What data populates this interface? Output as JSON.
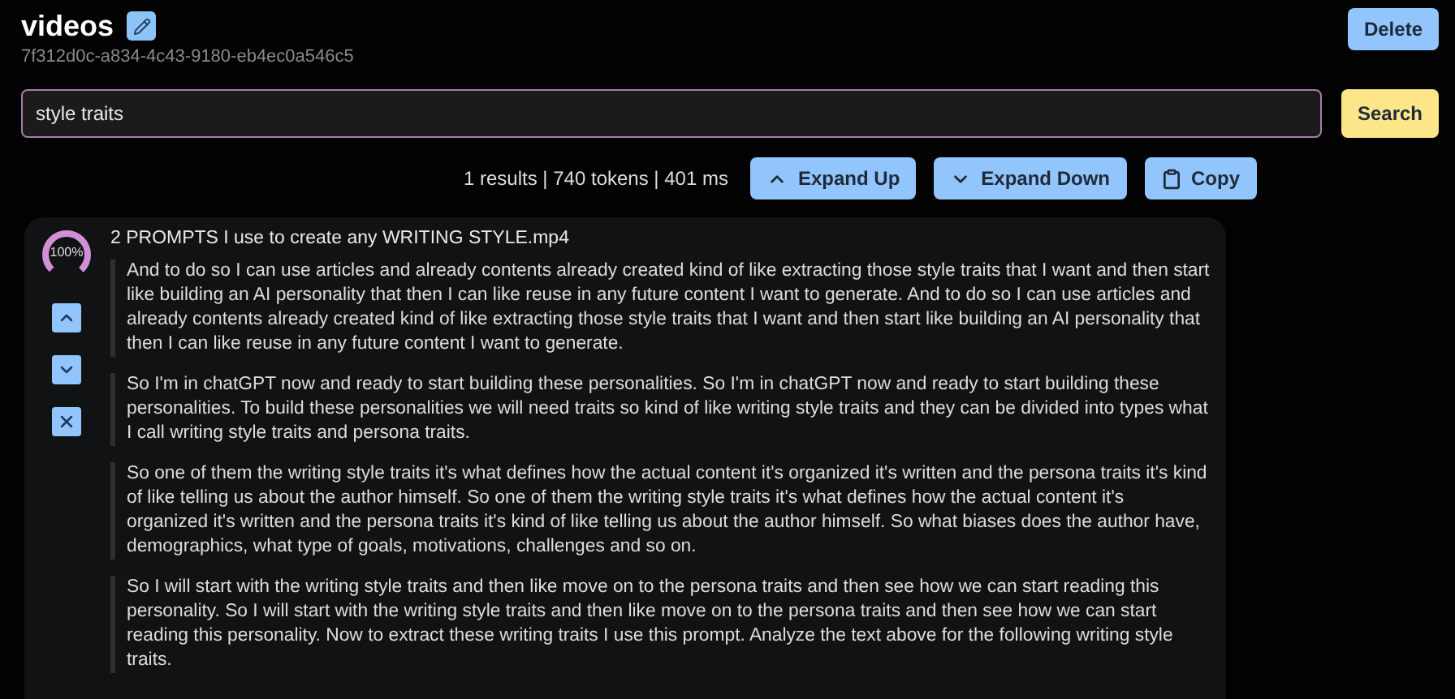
{
  "header": {
    "title": "videos",
    "id": "7f312d0c-a834-4c43-9180-eb4ec0a546c5",
    "delete_label": "Delete"
  },
  "search": {
    "value": "style traits",
    "button": "Search"
  },
  "stats": "1 results | 740 tokens | 401 ms",
  "actions": [
    {
      "kind": "up",
      "label": "Expand Up"
    },
    {
      "kind": "down",
      "label": "Expand Down"
    },
    {
      "kind": "copy",
      "label": "Copy"
    }
  ],
  "result": {
    "score": {
      "reading": "100%"
    },
    "file": "2 PROMPTS I use to create any WRITING STYLE.mp4",
    "controls": [
      {
        "kind": "up"
      },
      {
        "kind": "down"
      },
      {
        "kind": "close"
      }
    ],
    "paragraphs": [
      "And to do so I can use articles and already contents already created kind of like extracting those style traits that I want and then start like building an AI personality that then I can like reuse in any future content I want to generate. And to do so I can use articles and already contents already created kind of like extracting those style traits that I want and then start like building an AI personality that then I can like reuse in any future content I want to generate.",
      "So I'm in chatGPT now and ready to start building these personalities. So I'm in chatGPT now and ready to start building these personalities. To build these personalities we will need traits so kind of like writing style traits and they can be divided into types what I call writing style traits and persona traits.",
      "So one of them the writing style traits it's what defines how the actual content it's organized it's written and the persona traits it's kind of like telling us about the author himself. So one of them the writing style traits it's what defines how the actual content it's organized it's written and the persona traits it's kind of like telling us about the author himself. So what biases does the author have, demographics, what type of goals, motivations, challenges and so on.",
      "So I will start with the writing style traits and then like move on to the persona traits and then see how we can start reading this personality. So I will start with the writing style traits and then like move on to the persona traits and then see how we can start reading this personality. Now to extract these writing traits I use this prompt. Analyze the text above for the following writing style traits."
    ]
  }
}
